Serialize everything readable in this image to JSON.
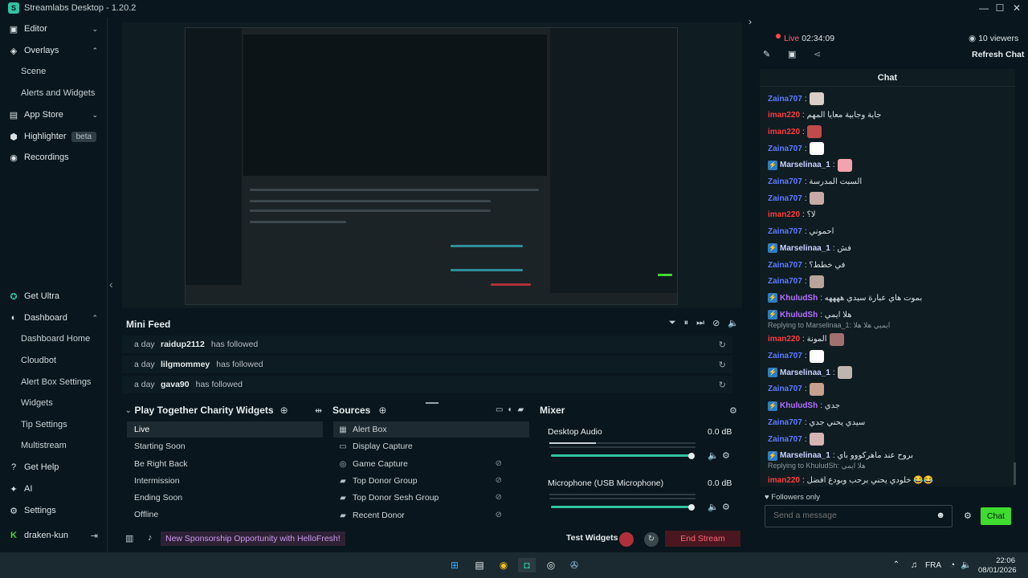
{
  "window": {
    "title": "Streamlabs Desktop - 1.20.2",
    "minimize": "—",
    "maximize": "☐",
    "close": "✕"
  },
  "nav": {
    "items": [
      {
        "label": "Editor",
        "icon": "editor-icon",
        "glyph": "▣",
        "chev": "⌄"
      },
      {
        "label": "Overlays",
        "icon": "overlays-icon",
        "glyph": "◈",
        "chev": "⌃"
      },
      {
        "label": "App Store",
        "icon": "app-store-icon",
        "glyph": "▤",
        "chev": "⌄"
      },
      {
        "label": "Highlighter",
        "icon": "highlighter-icon",
        "glyph": "⬢",
        "badge": "beta"
      },
      {
        "label": "Recordings",
        "icon": "recordings-icon",
        "glyph": "◉"
      }
    ],
    "overlay_subs": [
      "Scene",
      "Alerts and Widgets"
    ],
    "bottom_items": [
      {
        "label": "Get Ultra",
        "icon": "ultra-icon",
        "glyph": "✪"
      },
      {
        "label": "Dashboard",
        "icon": "dashboard-icon",
        "glyph": "◐",
        "chev": "⌃"
      },
      {
        "label": "Get Help",
        "icon": "help-icon",
        "glyph": "?"
      },
      {
        "label": "AI",
        "icon": "ai-icon",
        "glyph": "✦"
      },
      {
        "label": "Settings",
        "icon": "settings-gear-icon",
        "glyph": "⚙"
      }
    ],
    "dashboard_subs": [
      "Dashboard Home",
      "Cloudbot",
      "Alert Box Settings",
      "Widgets",
      "Tip Settings",
      "Multistream"
    ],
    "user": "draken-kun",
    "logout_glyph": "⇥",
    "collapse_glyph": "‹"
  },
  "minifeed": {
    "title": "Mini Feed",
    "tools": [
      "⏷",
      "⏸",
      "⏭",
      "⊘",
      "🔈"
    ],
    "rows": [
      {
        "when": "a day",
        "who": "raidup2112",
        "action": "has followed"
      },
      {
        "when": "a day",
        "who": "lilgmommey",
        "action": "has followed"
      },
      {
        "when": "a day",
        "who": "gava90",
        "action": "has followed"
      }
    ],
    "replay_glyph": "↻"
  },
  "scenes": {
    "title": "Play Together Charity Widgets",
    "add": "⊕",
    "toggle": "⇹",
    "items": [
      "Live",
      "Starting Soon",
      "Be Right Back",
      "Intermission",
      "Ending Soon",
      "Offline"
    ],
    "active": 0
  },
  "sources": {
    "title": "Sources",
    "add": "⊕",
    "items": [
      {
        "label": "Alert Box",
        "icon": "alert-box-icon",
        "glyph": "▦"
      },
      {
        "label": "Display Capture",
        "icon": "display-capture-icon",
        "glyph": "▭"
      },
      {
        "label": "Game Capture",
        "icon": "game-capture-icon",
        "glyph": "◎"
      },
      {
        "label": "Top Donor Group",
        "icon": "folder-icon",
        "glyph": "▰"
      },
      {
        "label": "Top Donor Sesh Group",
        "icon": "folder-icon",
        "glyph": "▰"
      },
      {
        "label": "Recent Donor",
        "icon": "folder-icon",
        "glyph": "▰"
      }
    ],
    "eye_glyph": "⊘"
  },
  "mixer": {
    "title": "Mixer",
    "channels": [
      {
        "label": "Desktop Audio",
        "db": "0.0 dB",
        "level": 0.96
      },
      {
        "label": "Microphone (USB Microphone)",
        "db": "0.0 dB",
        "level": 0.96
      }
    ]
  },
  "footer": {
    "sponsor": "New Sponsorship Opportunity with HelloFresh!",
    "test_widgets": "Test Widgets",
    "end_stream": "End Stream"
  },
  "chat": {
    "live_label": "Live",
    "timer": "02:34:09",
    "viewers": "10 viewers",
    "refresh": "Refresh Chat",
    "title": "Chat",
    "messages": [
      {
        "user": "Zaina707",
        "color": "#5e7cff",
        "text": ":",
        "emote": "#d9cfc8"
      },
      {
        "user": "iman220",
        "color": "#ff3b3b",
        "text": ": جاية وجابية معايا المهم"
      },
      {
        "user": "iman220",
        "color": "#ff3b3b",
        "text": ":",
        "emote": "#c24a4a"
      },
      {
        "user": "Zaina707",
        "color": "#5e7cff",
        "text": ":",
        "emote": "#ffffff"
      },
      {
        "user": "Marselinaa_1",
        "color": "#c9d2ff",
        "badge": true,
        "text": ":",
        "emote": "#f2a3ad"
      },
      {
        "user": "Zaina707",
        "color": "#5e7cff",
        "text": ": السبت المدرسة"
      },
      {
        "user": "Zaina707",
        "color": "#5e7cff",
        "text": ":",
        "emote": "#c9aaa8"
      },
      {
        "user": "iman220",
        "color": "#ff3b3b",
        "text": ": لا؟"
      },
      {
        "user": "Zaina707",
        "color": "#5e7cff",
        "text": ": احموني"
      },
      {
        "user": "Marselinaa_1",
        "color": "#c9d2ff",
        "badge": true,
        "text": ": فش"
      },
      {
        "user": "Zaina707",
        "color": "#5e7cff",
        "text": ": في خطط؟"
      },
      {
        "user": "Zaina707",
        "color": "#5e7cff",
        "text": ":",
        "emote": "#b8a49a"
      },
      {
        "user": "KhuludSh",
        "color": "#b470ff",
        "badge": true,
        "text": ": بموت هاي عبارة سيدي ههههه"
      },
      {
        "user": "KhuludSh",
        "color": "#b470ff",
        "badge": true,
        "text": ": هلا ايمي"
      },
      {
        "user": "iman220",
        "color": "#ff3b3b",
        "text": ": المونة",
        "reply": "Replying to Marselinaa_1: ايميي هلا هلا",
        "emote": "#a27070"
      },
      {
        "user": "Zaina707",
        "color": "#5e7cff",
        "text": ":",
        "emote": "#ffffff"
      },
      {
        "user": "Marselinaa_1",
        "color": "#c9d2ff",
        "badge": true,
        "text": ":",
        "emote": "#bfb5b0"
      },
      {
        "user": "Zaina707",
        "color": "#5e7cff",
        "text": ":",
        "emote": "#c7a08e"
      },
      {
        "user": "KhuludSh",
        "color": "#b470ff",
        "badge": true,
        "text": ": جدي"
      },
      {
        "user": "Zaina707",
        "color": "#5e7cff",
        "text": ": سيدي يحني جدي"
      },
      {
        "user": "Zaina707",
        "color": "#5e7cff",
        "text": ":",
        "emote": "#d7b4b4"
      },
      {
        "user": "Marselinaa_1",
        "color": "#c9d2ff",
        "badge": true,
        "text": ": بروح عند ماهركووو باي"
      },
      {
        "user": "iman220",
        "color": "#ff3b3b",
        "text": ": خلودي يحني برحب وبودع افضل 😂😂",
        "reply": "Replying to KhuludSh: هلا ايمي"
      }
    ],
    "followers_only": "Followers only",
    "placeholder": "Send a message",
    "send_label": "Chat"
  },
  "taskbar": {
    "lang": "FRA",
    "time": "22:06",
    "date": "08/01/2026"
  }
}
